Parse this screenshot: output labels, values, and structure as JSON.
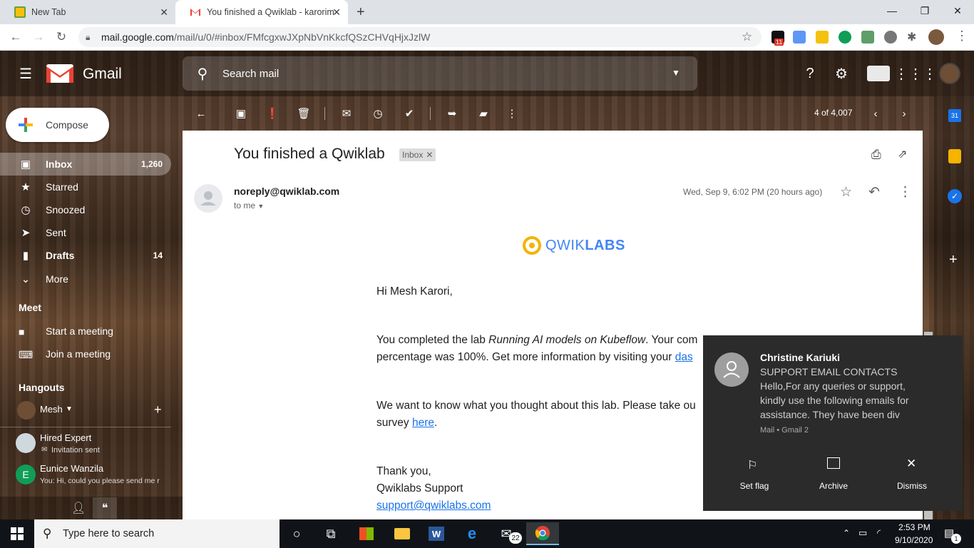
{
  "browser": {
    "tabs": [
      {
        "title": "New Tab"
      },
      {
        "title": "You finished a Qwiklab - karorim"
      }
    ],
    "url_host": "mail.google.com",
    "url_path": "/mail/u/0/#inbox/FMfcgxwJXpNbVnKkcfQSzCHVqHjxJzlW",
    "ext_badge": "11"
  },
  "gmail": {
    "brand": "Gmail",
    "search_placeholder": "Search mail",
    "compose_label": "Compose",
    "nav": [
      {
        "label": "Inbox",
        "count": "1,260",
        "icon": "inbox-icon"
      },
      {
        "label": "Starred",
        "count": "",
        "icon": "star-icon"
      },
      {
        "label": "Snoozed",
        "count": "",
        "icon": "clock-icon"
      },
      {
        "label": "Sent",
        "count": "",
        "icon": "send-icon"
      },
      {
        "label": "Drafts",
        "count": "14",
        "icon": "draft-icon"
      },
      {
        "label": "More",
        "count": "",
        "icon": "chevron-down-icon"
      }
    ],
    "meet": {
      "title": "Meet",
      "items": [
        {
          "label": "Start a meeting"
        },
        {
          "label": "Join a meeting"
        }
      ]
    },
    "hangouts": {
      "title": "Hangouts",
      "self": "Mesh",
      "contacts": [
        {
          "name": "Hired Expert",
          "status": "Invitation sent"
        },
        {
          "name": "Eunice Wanzila",
          "status": "You: Hi, could you please send me r",
          "initial": "E"
        }
      ]
    },
    "pager": "4 of 4,007"
  },
  "email": {
    "subject": "You finished a Qwiklab",
    "label": "Inbox",
    "sender": "noreply@qwiklab.com",
    "to": "to me",
    "date": "Wed, Sep 9, 6:02 PM (20 hours ago)",
    "logo_prefix": "QWIK",
    "logo_suffix": "LABS",
    "greeting": "Hi Mesh Karori,",
    "para1_a": "You completed the lab ",
    "para1_em": "Running AI models on Kubeflow",
    "para1_b": ". Your com",
    "para1_line2": "percentage was 100%. Get more information by visiting your ",
    "para1_link": "das",
    "para2_line1": "We want to know what you thought about this lab. Please take ou",
    "para2_line2": "survey ",
    "para2_link": "here",
    "para2_end": ".",
    "thanks": "Thank you,",
    "signature": "Qwiklabs Support",
    "support_email": "support@qwiklabs.com"
  },
  "notification": {
    "sender": "Christine Kariuki",
    "subject": "SUPPORT EMAIL CONTACTS",
    "preview_1": "Hello,For any queries or support,",
    "preview_2": "kindly use the following emails for",
    "preview_3": "assistance. They have been div",
    "source": "Mail • Gmail 2",
    "actions": [
      "Set flag",
      "Archive",
      "Dismiss"
    ]
  },
  "taskbar": {
    "search_placeholder": "Type here to search",
    "mail_badge": "22",
    "time": "2:53 PM",
    "date": "9/10/2020",
    "notif_count": "1"
  },
  "colors": {
    "accent_blue": "#1a73e8",
    "gmail_red": "#ea4335",
    "qwik_yellow": "#f4b400"
  }
}
